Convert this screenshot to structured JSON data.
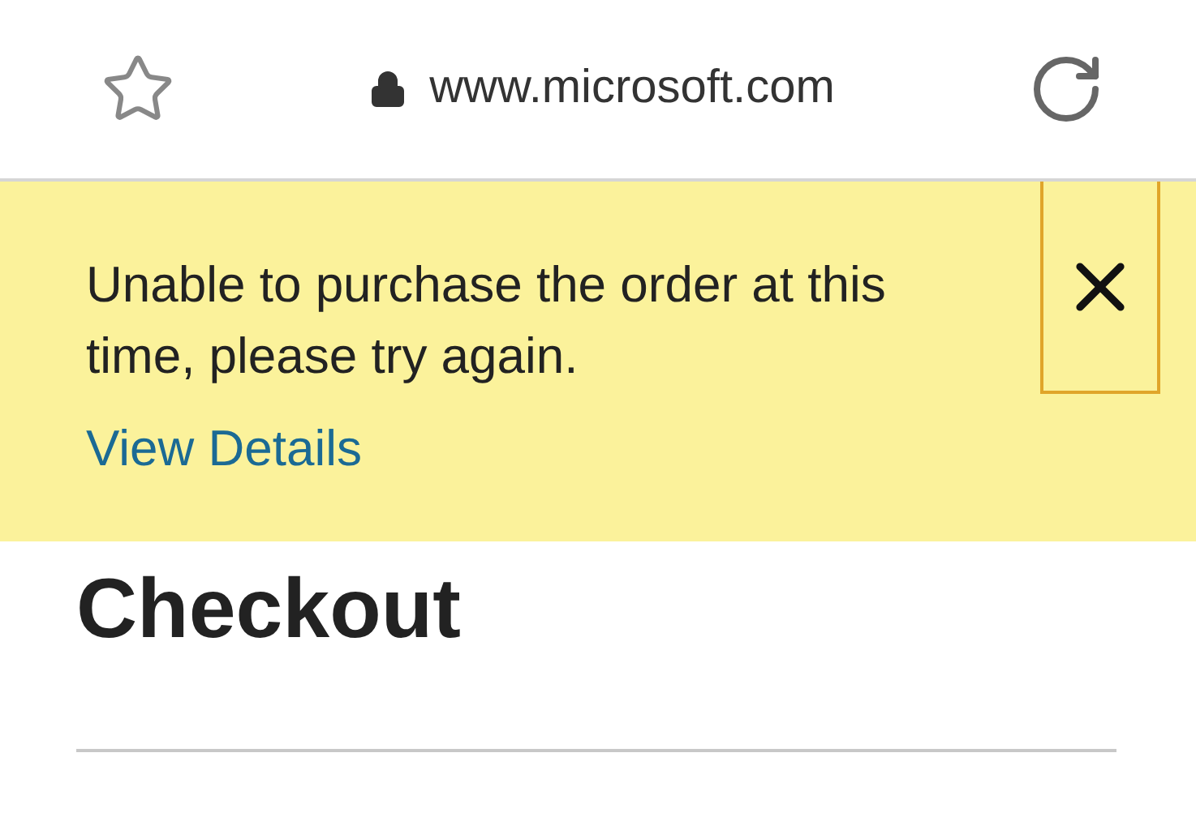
{
  "address_bar": {
    "url": "www.microsoft.com"
  },
  "alert": {
    "message": "Unable to purchase the order at this time, please try again.",
    "link": "View Details"
  },
  "page": {
    "heading": "Checkout"
  }
}
